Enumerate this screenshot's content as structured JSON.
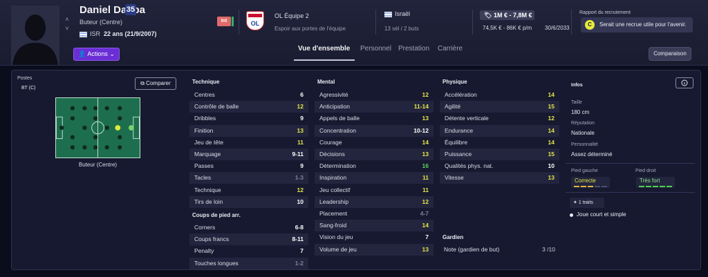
{
  "player": {
    "name": "Daniel Dappa",
    "number": "35",
    "position": "Buteur (Centre)",
    "nation": "ISR",
    "age": "22 ans (21/9/2007)",
    "actions_label": "Actions",
    "int_badge": "Int"
  },
  "club": {
    "name": "OL Équipe 2",
    "subtitle": "Espoir aux portes de l'équipe"
  },
  "international": {
    "country": "Israël",
    "caps": "13 sél / 2 buts"
  },
  "value": {
    "range": "1M € - 7,8M €",
    "wage": "74,5K € - 86K € p/m",
    "contract": "30/6/2033"
  },
  "recruitment": {
    "title": "Rapport du recrutement",
    "grade": "C",
    "text": "Serait une recrue utile pour l'avenir."
  },
  "tabs": [
    "Vue d'ensemble",
    "Personnel",
    "Prestation",
    "Carrière"
  ],
  "compare_button": "Comparaison",
  "positions": {
    "label": "Postes",
    "value": "BT (C)",
    "compare_label": "Comparer",
    "caption": "Buteur (Centre)"
  },
  "technique": {
    "title": "Technique",
    "rows": [
      {
        "label": "Centres",
        "value": "6",
        "color": "#ffffff"
      },
      {
        "label": "Contrôle de balle",
        "value": "12",
        "color": "#e4e64a"
      },
      {
        "label": "Dribbles",
        "value": "9",
        "color": "#ffffff"
      },
      {
        "label": "Finition",
        "value": "13",
        "color": "#e4e64a"
      },
      {
        "label": "Jeu de tête",
        "value": "11",
        "color": "#e4e64a"
      },
      {
        "label": "Marquage",
        "value": "9-11",
        "color": "#ffffff"
      },
      {
        "label": "Passes",
        "value": "9",
        "color": "#ffffff"
      },
      {
        "label": "Tacles",
        "value": "1-3",
        "color": "#7d809a"
      },
      {
        "label": "Technique",
        "value": "12",
        "color": "#e4e64a"
      },
      {
        "label": "Tirs de loin",
        "value": "10",
        "color": "#ffffff"
      }
    ]
  },
  "setpieces": {
    "title": "Coups de pied arr.",
    "rows": [
      {
        "label": "Corners",
        "value": "6-8",
        "color": "#ffffff"
      },
      {
        "label": "Coups francs",
        "value": "8-11",
        "color": "#ffffff"
      },
      {
        "label": "Penalty",
        "value": "7",
        "color": "#ffffff"
      },
      {
        "label": "Touches longues",
        "value": "1-2",
        "color": "#7d809a"
      }
    ]
  },
  "mental": {
    "title": "Mental",
    "rows": [
      {
        "label": "Agressivité",
        "value": "12",
        "color": "#e4e64a"
      },
      {
        "label": "Anticipation",
        "value": "11-14",
        "color": "#e4e64a"
      },
      {
        "label": "Appels de balle",
        "value": "13",
        "color": "#e4e64a"
      },
      {
        "label": "Concentration",
        "value": "10-12",
        "color": "#ffffff"
      },
      {
        "label": "Courage",
        "value": "14",
        "color": "#e4e64a"
      },
      {
        "label": "Décisions",
        "value": "13",
        "color": "#e4e64a"
      },
      {
        "label": "Détermination",
        "value": "16",
        "color": "#5fd35f"
      },
      {
        "label": "Inspiration",
        "value": "11",
        "color": "#e4e64a"
      },
      {
        "label": "Jeu collectif",
        "value": "11",
        "color": "#e4e64a"
      },
      {
        "label": "Leadership",
        "value": "12",
        "color": "#e4e64a"
      },
      {
        "label": "Placement",
        "value": "4-7",
        "color": "#7d809a"
      },
      {
        "label": "Sang-froid",
        "value": "14",
        "color": "#e4e64a"
      },
      {
        "label": "Vision du jeu",
        "value": "7",
        "color": "#ffffff"
      },
      {
        "label": "Volume de jeu",
        "value": "13",
        "color": "#e4e64a"
      }
    ]
  },
  "physique": {
    "title": "Physique",
    "rows": [
      {
        "label": "Accélération",
        "value": "14",
        "color": "#e4e64a"
      },
      {
        "label": "Agilité",
        "value": "15",
        "color": "#e4e64a"
      },
      {
        "label": "Détente verticale",
        "value": "12",
        "color": "#e4e64a"
      },
      {
        "label": "Endurance",
        "value": "14",
        "color": "#e4e64a"
      },
      {
        "label": "Équilibre",
        "value": "14",
        "color": "#e4e64a"
      },
      {
        "label": "Puissance",
        "value": "15",
        "color": "#e4e64a"
      },
      {
        "label": "Qualités phys. nat.",
        "value": "10",
        "color": "#ffffff"
      },
      {
        "label": "Vitesse",
        "value": "13",
        "color": "#e4e64a"
      }
    ]
  },
  "gardien": {
    "title": "Gardien",
    "label": "Note (gardien de but)",
    "value": "3 /10"
  },
  "infos": {
    "title": "Infos",
    "height_label": "Taille",
    "height": "180 cm",
    "rep_label": "Réputation",
    "rep": "Nationale",
    "pers_label": "Personnalité",
    "pers": "Assez déterminé",
    "left_foot_label": "Pied gauche",
    "left_foot": "Correcte",
    "right_foot_label": "Pied droit",
    "right_foot": "Très fort",
    "traits_label": "1 traits",
    "trait": "Joue court et simple"
  }
}
